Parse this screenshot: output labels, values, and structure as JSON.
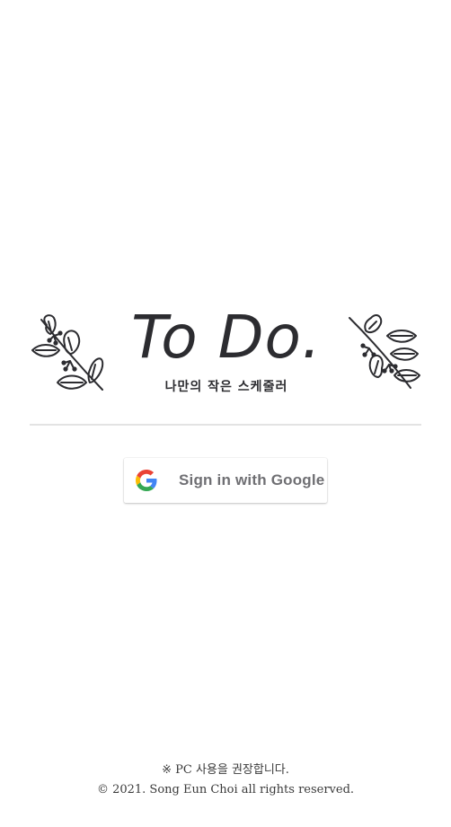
{
  "header": {
    "title": "To Do.",
    "subtitle": "나만의 작은 스케줄러",
    "left_ornament_icon": "leaf-branch-icon",
    "right_ornament_icon": "leaf-branch-icon"
  },
  "login": {
    "google_button_label": "Sign in with Google",
    "google_icon": "google-g-icon"
  },
  "footer": {
    "notice": "※ PC 사용을 권장합니다.",
    "copyright": "© 2021. Song Eun Choi all rights reserved."
  },
  "colors": {
    "ink": "#2c2c30",
    "divider": "#e3e3e3",
    "button_text": "#6f6f73",
    "google_blue": "#4285F4",
    "google_red": "#EA4335",
    "google_yellow": "#FBBC05",
    "google_green": "#34A853"
  }
}
